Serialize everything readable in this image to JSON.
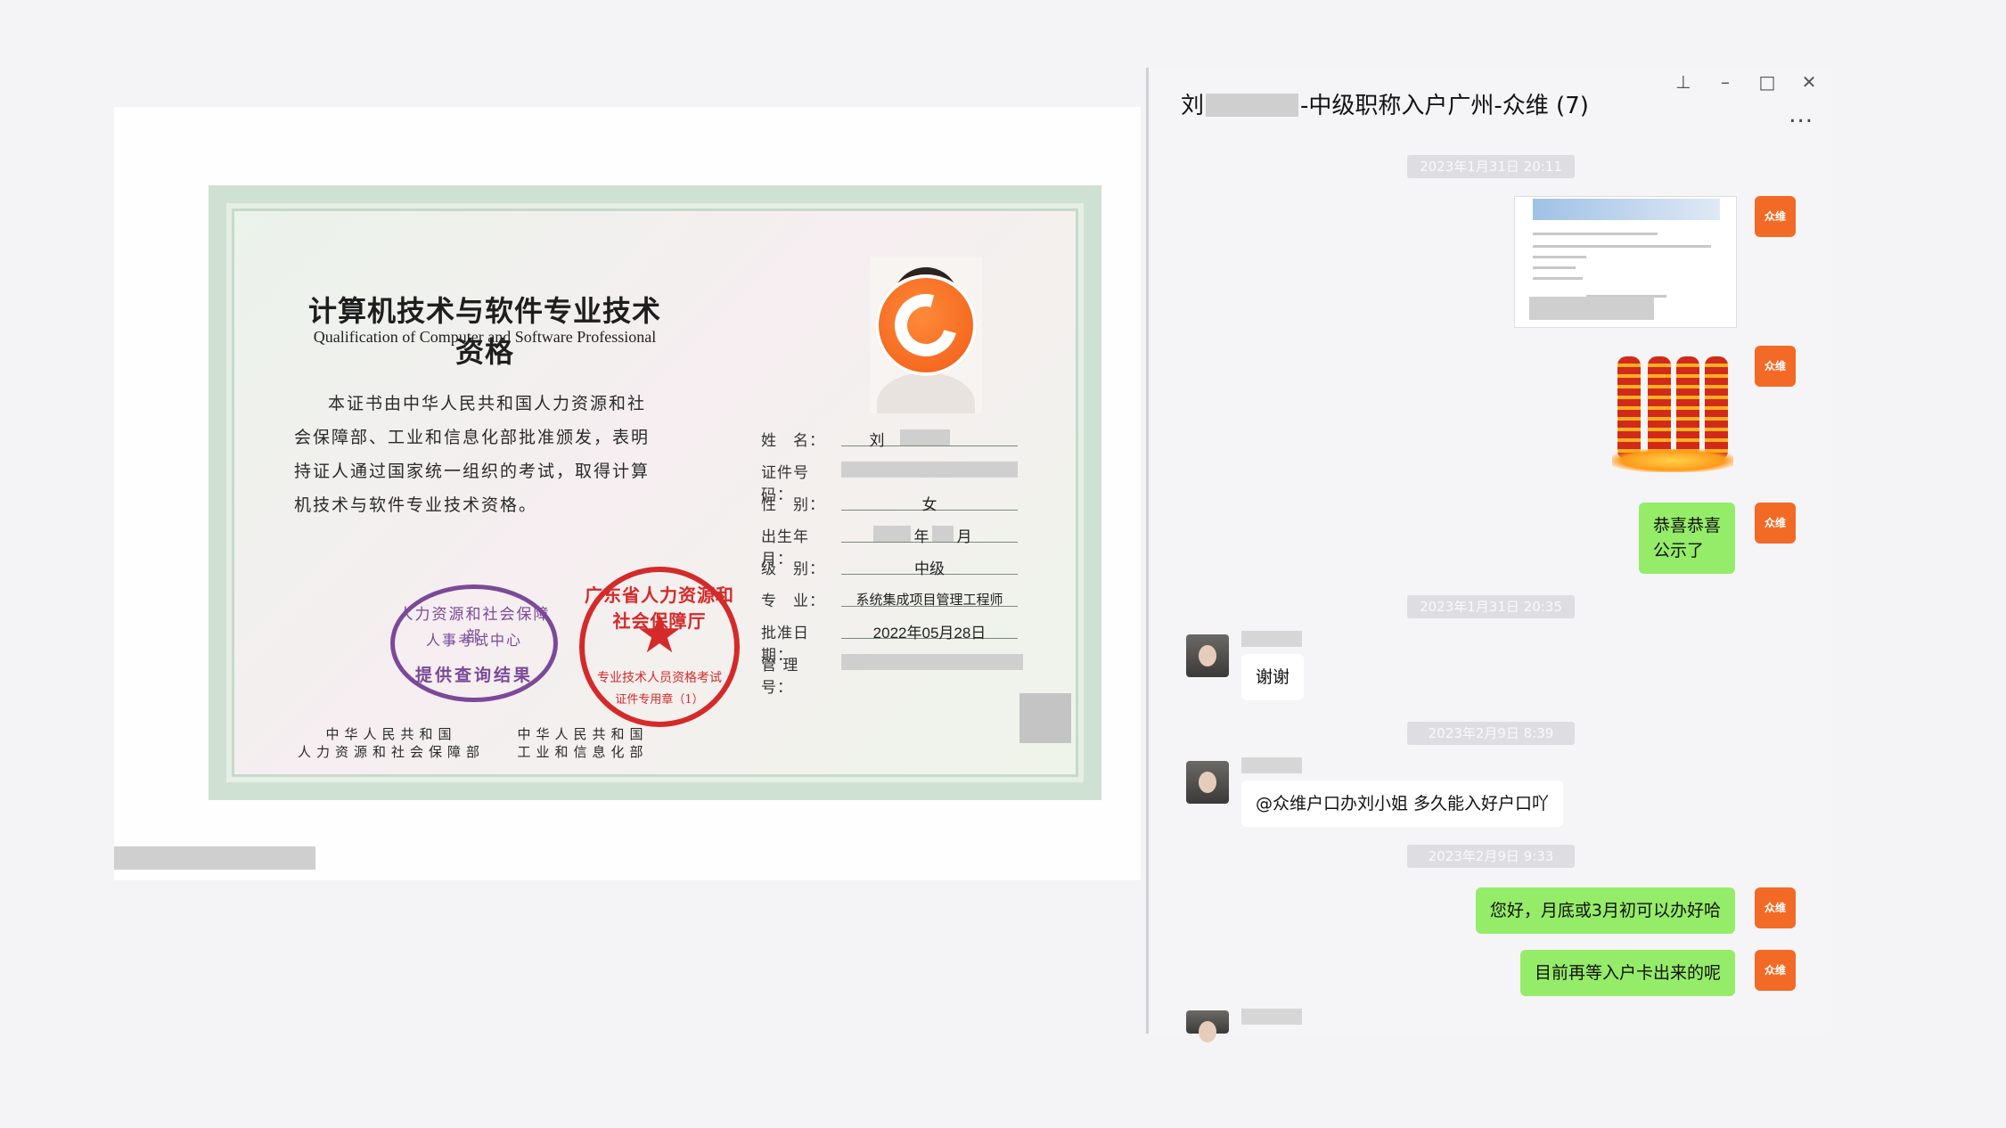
{
  "certificate": {
    "title": "计算机技术与软件专业技术资格",
    "subtitle": "Qualification of Computer and Software Professional",
    "body": "本证书由中华人民共和国人力资源和社会保障部、工业和信息化部批准颁发，表明持证人通过国家统一组织的考试，取得计算机技术与软件专业技术资格。",
    "fields": {
      "name_label": "姓　名：",
      "name_value": "刘",
      "id_label": "证件号码：",
      "gender_label": "性　别：",
      "gender_value": "女",
      "birth_label": "出生年月：",
      "birth_year_suffix": "年",
      "birth_month_suffix": "月",
      "level_label": "级　别：",
      "level_value": "中级",
      "major_label": "专　业：",
      "major_value": "系统集成项目管理工程师",
      "approval_label": "批准日期：",
      "approval_value": "2022年05月28日",
      "mgmt_label": "管 理 号："
    },
    "seal_purple": {
      "line1": "人力资源和社会保障部",
      "line2": "人事考试中心",
      "line3": "提供查询结果"
    },
    "seal_red": {
      "line1": "广东省人力资源和社会保障厅",
      "line2": "专业技术人员资格考试",
      "line3": "证件专用章（1）"
    },
    "issuer_left": "中华人民共和国\n人力资源和社会保障部",
    "issuer_right": "中华人民共和国\n工业和信息化部"
  },
  "chat": {
    "title_prefix": "刘",
    "title_suffix": "-中级职称入户广州-众维 (7)",
    "window_controls": [
      "pin-icon",
      "minimize-icon",
      "maximize-icon",
      "close-icon"
    ],
    "more": "...",
    "my_avatar_text": "众维",
    "messages": [
      {
        "type": "timestamp",
        "text": "2023年1月31日 20:11"
      },
      {
        "type": "image",
        "sender": "me",
        "desc_icon": "document-screenshot"
      },
      {
        "type": "image",
        "sender": "me",
        "desc_icon": "firecrackers"
      },
      {
        "type": "text",
        "sender": "me",
        "text": "恭喜恭喜\n公示了"
      },
      {
        "type": "timestamp",
        "text": "2023年1月31日 20:35"
      },
      {
        "type": "text",
        "sender": "other",
        "text": "谢谢"
      },
      {
        "type": "timestamp",
        "text": "2023年2月9日 8:39"
      },
      {
        "type": "text",
        "sender": "other",
        "text": "@众维户口办刘小姐 多久能入好户口吖"
      },
      {
        "type": "timestamp",
        "text": "2023年2月9日 9:33"
      },
      {
        "type": "text",
        "sender": "me",
        "text": "您好，月底或3月初可以办好哈"
      },
      {
        "type": "text",
        "sender": "me",
        "text": "目前再等入户卡出来的呢"
      }
    ]
  },
  "colors": {
    "bubble_me": "#95ec69",
    "bubble_other": "#ffffff",
    "brand_orange": "#f26a26",
    "seal_red": "#d42a2a",
    "seal_purple": "#7a4a98"
  }
}
